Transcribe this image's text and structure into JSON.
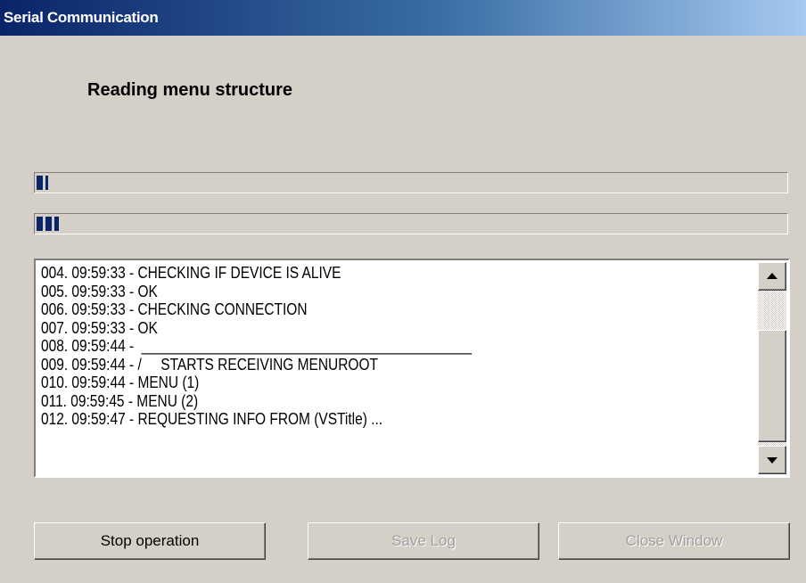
{
  "window": {
    "title": "Serial Communication"
  },
  "status": {
    "heading": "Reading menu structure"
  },
  "progress": {
    "primary": {
      "value_percent": 1.5
    },
    "secondary": {
      "value_percent": 3
    }
  },
  "log": {
    "lines": [
      "004. 09:59:33 - CHECKING IF DEVICE IS ALIVE",
      "005. 09:59:33 - OK",
      "006. 09:59:33 - CHECKING CONNECTION",
      "007. 09:59:33 - OK",
      "008. 09:59:44 -  ___________________________________________",
      "009. 09:59:44 - /     STARTS RECEIVING MENUROOT",
      "010. 09:59:44 - MENU (1)",
      "011. 09:59:45 - MENU (2)",
      "012. 09:59:47 - REQUESTING INFO FROM (VSTitle) ..."
    ]
  },
  "buttons": {
    "stop": "Stop operation",
    "save": "Save Log",
    "close": "Close Window"
  },
  "colors": {
    "progress_fill": "#0a246a",
    "title_bar_start": "#0a246a",
    "title_bar_end": "#a6caf0",
    "window_face": "#d4d0c8"
  }
}
